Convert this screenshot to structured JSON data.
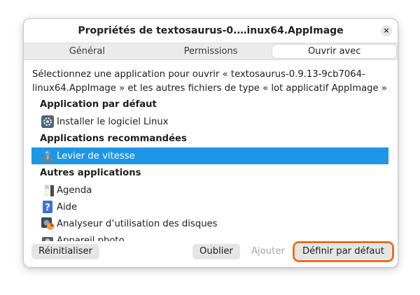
{
  "dialog": {
    "title": "Propriétés de textosaurus-0.…inux64.AppImage",
    "close_symbol": "×"
  },
  "tabs": [
    {
      "label": "Général",
      "active": false
    },
    {
      "label": "Permissions",
      "active": false
    },
    {
      "label": "Ouvrir avec",
      "active": true
    }
  ],
  "description": "Sélectionnez une application pour ouvrir « textosaurus-0.9.13-9cb7064-linux64.AppImage » et les autres fichiers de type « lot applicatif AppImage »",
  "list": {
    "default_header": "Application par défaut",
    "default_apps": [
      {
        "label": "Installer le logiciel Linux",
        "icon": "settings-gear-icon"
      }
    ],
    "recommended_header": "Applications recommandées",
    "recommended_apps": [
      {
        "label": "Levier de vitesse",
        "icon": "gear-shift-icon",
        "selected": true
      }
    ],
    "other_header": "Autres applications",
    "other_apps": [
      {
        "label": "Agenda",
        "icon": "calendar-icon"
      },
      {
        "label": "Aide",
        "icon": "help-icon"
      },
      {
        "label": "Analyseur d’utilisation des disques",
        "icon": "disk-usage-icon"
      },
      {
        "label": "Appareil photo",
        "icon": "camera-icon"
      }
    ]
  },
  "footer": {
    "reset_label": "Réinitialiser",
    "forget_label": "Oublier",
    "add_label": "Ajouter",
    "set_default_label": "Définir par défaut"
  },
  "colors": {
    "selection": "#1d96e8",
    "focus_ring": "#f26b1d",
    "button_bg": "#e5e5e5"
  }
}
